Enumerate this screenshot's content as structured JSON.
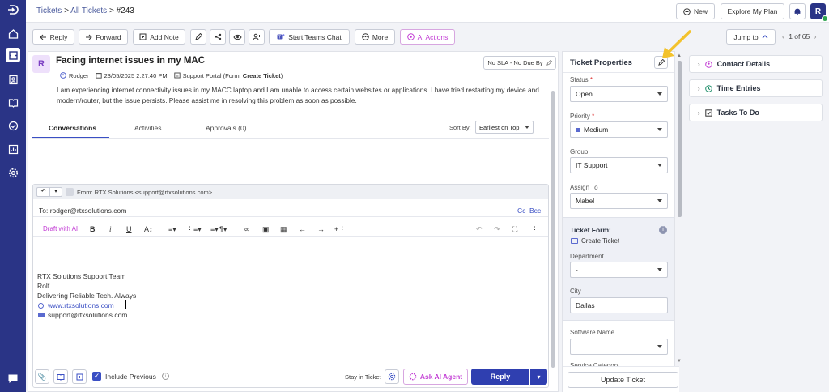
{
  "breadcrumb": {
    "tickets": "Tickets",
    "all": "All Tickets",
    "id": "#243",
    "sep1": ">",
    "sep2": ">"
  },
  "header": {
    "new": "New",
    "explore": "Explore My Plan",
    "avatar": "R"
  },
  "toolbar": {
    "reply": "Reply",
    "forward": "Forward",
    "add_note": "Add Note",
    "teams": "Start Teams Chat",
    "more": "More",
    "ai": "AI Actions",
    "jump": "Jump to",
    "pager": "1 of 65"
  },
  "ticket": {
    "avatar": "R",
    "title": "Facing internet issues in my MAC",
    "sla": "No SLA - No Due By",
    "requester": "Rodger",
    "date": "23/05/2025 2:27:40 PM",
    "source_prefix": "Support Portal (Form: ",
    "source_form": "Create Ticket",
    "source_suffix": ")",
    "body": "I am experiencing internet connectivity issues in my MACC laptop and I am unable to access certain websites or applications. I have tried restarting my device and modern/router, but the issue persists. Please assist me in resolving this problem as soon as possible."
  },
  "tabs": {
    "conv": "Conversations",
    "act": "Activities",
    "appr": "Approvals (0)",
    "sort_label": "Sort By:",
    "sort_value": "Earliest on Top"
  },
  "reply": {
    "from": "From: RTX Solutions <support@rtxsolutions.com>",
    "to": "To: rodger@rtxsolutions.com",
    "cc": "Cc",
    "bcc": "Bcc",
    "draft_ai": "Draft with AI",
    "sig": [
      "RTX Solutions Support Team",
      "Rolf",
      "Delivering Reliable Tech. Always"
    ],
    "web": "www.rtxsolutions.com",
    "mail": "support@rtxsolutions.com",
    "include_prev": "Include Previous",
    "stay": "Stay in Ticket",
    "ask_ai": "Ask AI Agent",
    "send": "Reply"
  },
  "props": {
    "title": "Ticket Properties",
    "status_l": "Status",
    "status_v": "Open",
    "priority_l": "Priority",
    "priority_v": "Medium",
    "group_l": "Group",
    "group_v": "IT Support",
    "assign_l": "Assign To",
    "assign_v": "Mabel",
    "form_title": "Ticket Form:",
    "form_v": "Create Ticket",
    "dept_l": "Department",
    "dept_v": "-",
    "city_l": "City",
    "city_v": "Dallas",
    "sw_l": "Software Name",
    "sw_v": "",
    "svc_l": "Service Category",
    "update": "Update Ticket",
    "req": "*"
  },
  "right": {
    "contact": "Contact Details",
    "time": "Time Entries",
    "tasks": "Tasks To Do"
  },
  "colors": {
    "sidebar": "#2a3486",
    "primary": "#3a4fc4",
    "ai": "#c23bd4",
    "arrow": "#f3c22c",
    "priority": "#5a6acf"
  }
}
